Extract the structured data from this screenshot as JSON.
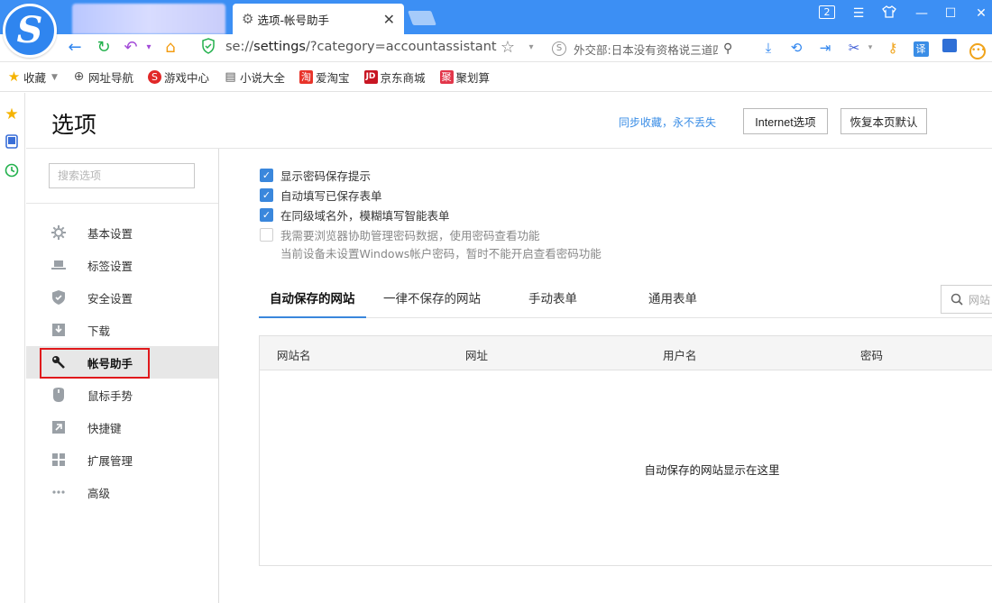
{
  "browser": {
    "active_tab_title": "选项-帐号助手",
    "url_prefix": "se://",
    "url_path": "settings",
    "url_query": "/?category=accountassistant",
    "search_query": "外交部:日本没有资格说三道四",
    "window_badge": "2",
    "colors": {
      "titlebar": "#3c8ff4",
      "accent": "#3a87dc",
      "highlight": "#e0191c"
    }
  },
  "bookmarks": [
    {
      "label": "收藏",
      "icon": "star-icon"
    },
    {
      "label": "网址导航",
      "icon": "globe-icon"
    },
    {
      "label": "游戏中心",
      "icon": "game-icon"
    },
    {
      "label": "小说大全",
      "icon": "book-icon"
    },
    {
      "label": "爱淘宝",
      "icon": "taobao-icon"
    },
    {
      "label": "京东商城",
      "icon": "jd-icon"
    },
    {
      "label": "聚划算",
      "icon": "juhuasuan-icon"
    }
  ],
  "header": {
    "title": "选项",
    "sync_link": "同步收藏，永不丢失",
    "internet_options_button": "Internet选项",
    "restore_defaults_button": "恢复本页默认"
  },
  "sidebar": {
    "search_placeholder": "搜索选项",
    "items": [
      {
        "label": "基本设置",
        "icon": "gear-icon"
      },
      {
        "label": "标签设置",
        "icon": "tab-icon"
      },
      {
        "label": "安全设置",
        "icon": "shield-icon"
      },
      {
        "label": "下载",
        "icon": "download-icon"
      },
      {
        "label": "帐号助手",
        "icon": "key-icon",
        "active": true
      },
      {
        "label": "鼠标手势",
        "icon": "mouse-icon"
      },
      {
        "label": "快捷键",
        "icon": "shortcut-icon"
      },
      {
        "label": "扩展管理",
        "icon": "extensions-icon"
      },
      {
        "label": "高级",
        "icon": "more-icon"
      }
    ]
  },
  "options": [
    {
      "label": "显示密码保存提示",
      "checked": true
    },
    {
      "label": "自动填写已保存表单",
      "checked": true
    },
    {
      "label": "在同级域名外，模糊填写智能表单",
      "checked": true
    },
    {
      "label": "我需要浏览器协助管理密码数据，使用密码查看功能",
      "checked": false,
      "disabled": true
    }
  ],
  "options_note": "当前设备未设置Windows帐户密码，暂时不能开启查看密码功能",
  "tabs": [
    {
      "label": "自动保存的网站",
      "active": true
    },
    {
      "label": "一律不保存的网站"
    },
    {
      "label": "手动表单"
    },
    {
      "label": "通用表单"
    }
  ],
  "filter_placeholder": "网站",
  "table": {
    "columns": [
      "网站名",
      "网址",
      "用户名",
      "密码"
    ],
    "empty_message": "自动保存的网站显示在这里"
  }
}
